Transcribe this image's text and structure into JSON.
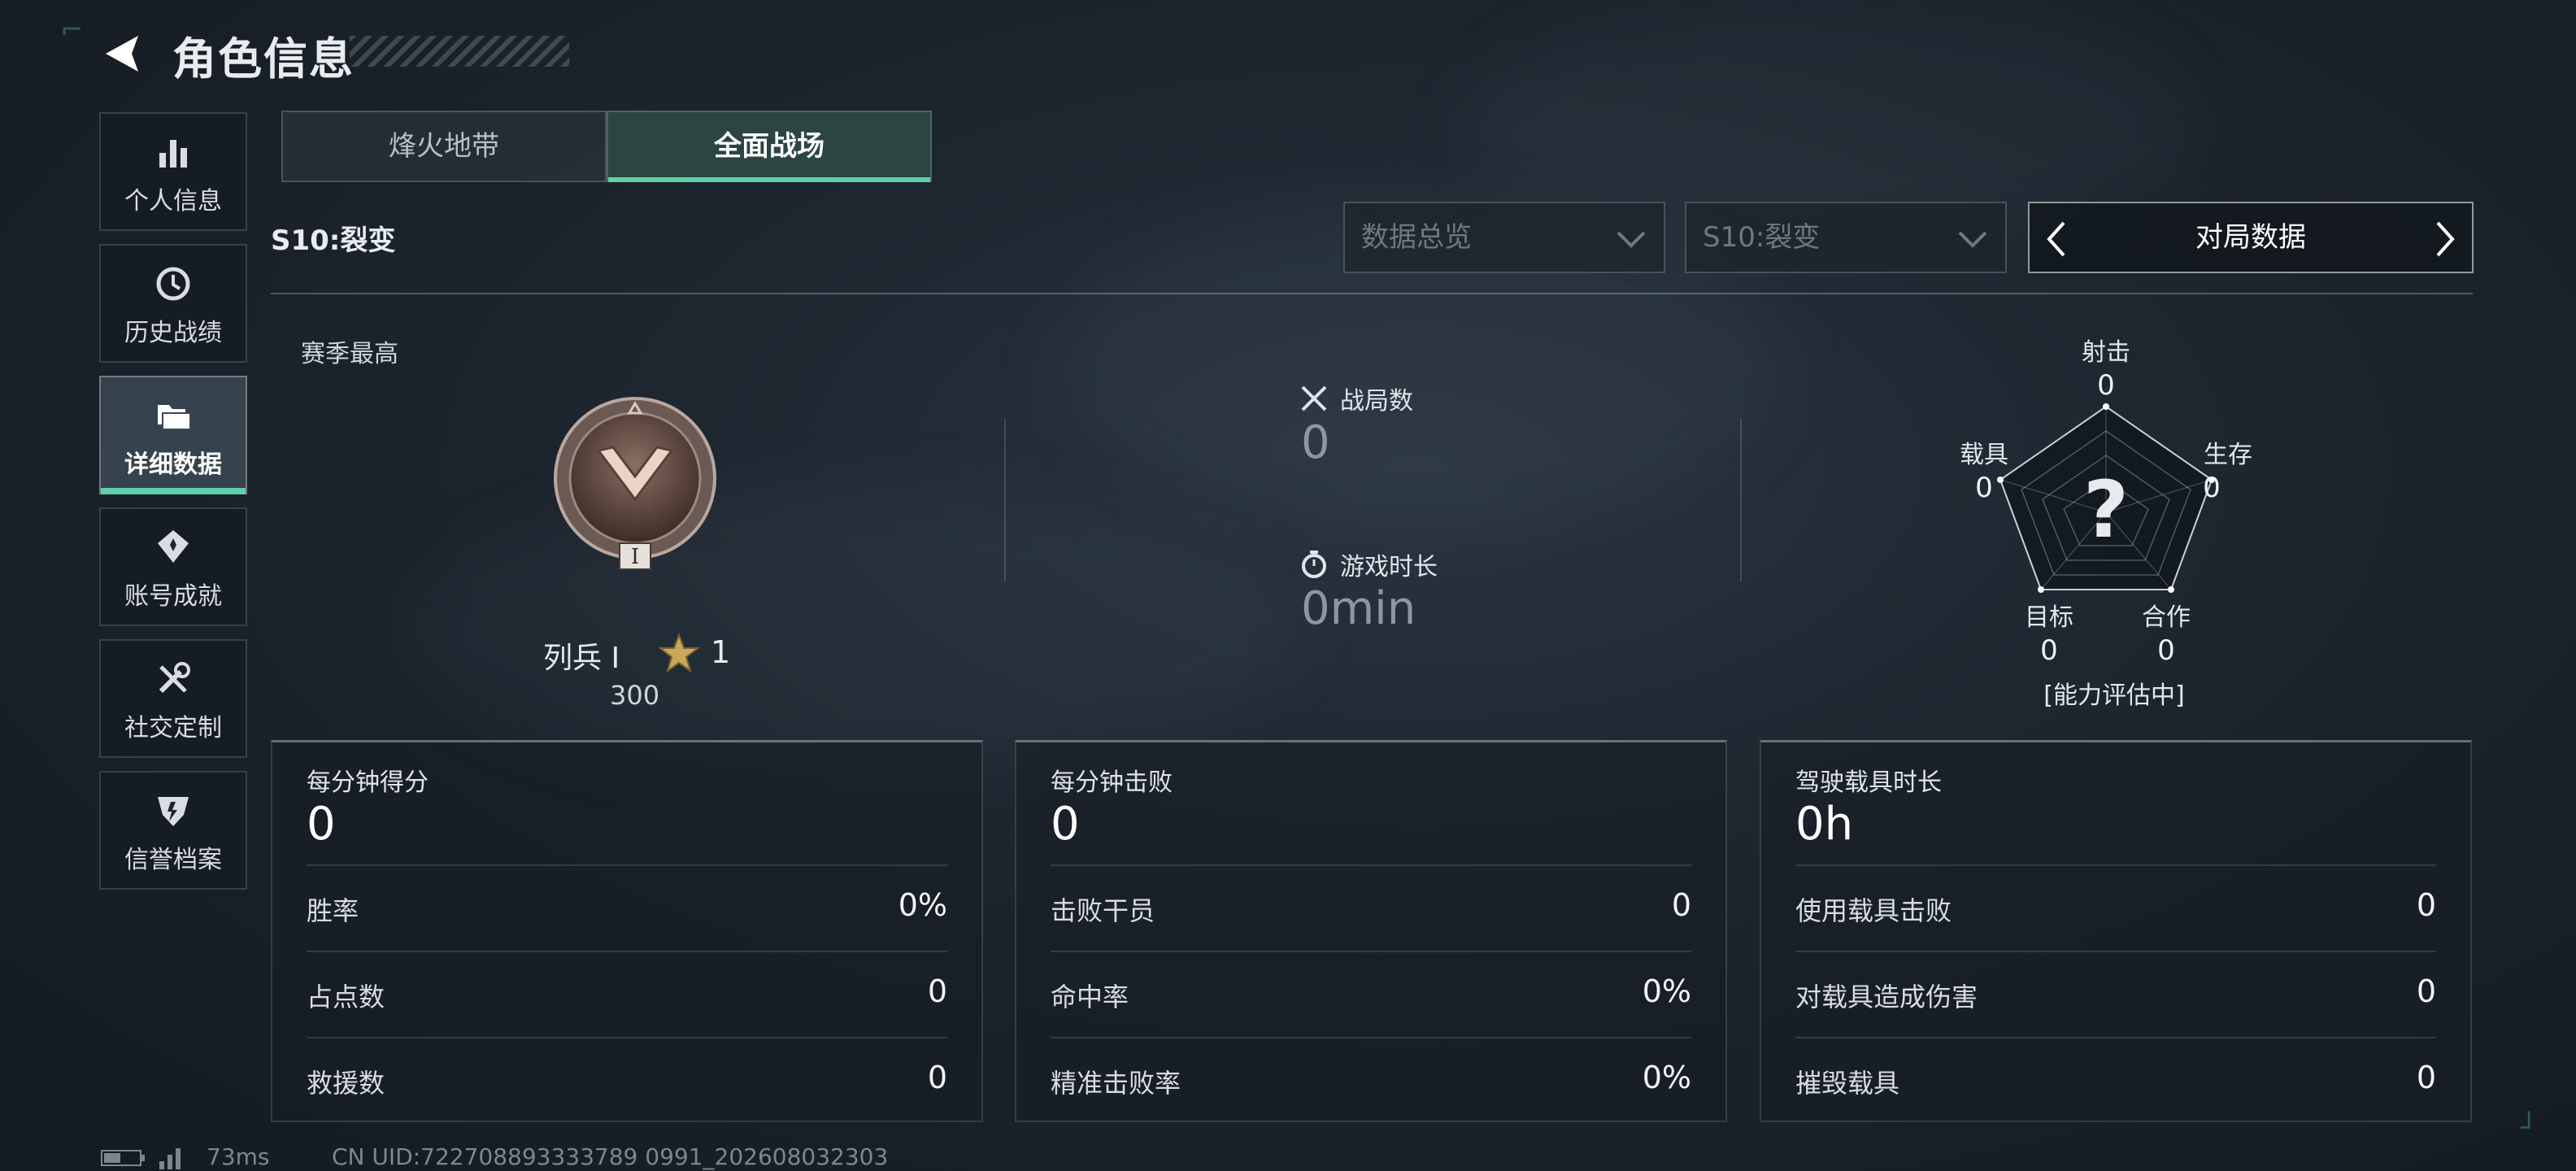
{
  "header": {
    "title": "角色信息"
  },
  "sidebar": {
    "items": [
      {
        "label": "个人信息",
        "icon": "bar-chart-icon"
      },
      {
        "label": "历史战绩",
        "icon": "history-clock-icon"
      },
      {
        "label": "详细数据",
        "icon": "folder-icon",
        "active": true
      },
      {
        "label": "账号成就",
        "icon": "achievement-icon"
      },
      {
        "label": "社交定制",
        "icon": "tools-icon"
      },
      {
        "label": "信誉档案",
        "icon": "credit-shield-icon"
      }
    ]
  },
  "tabs": [
    {
      "label": "烽火地带",
      "active": false
    },
    {
      "label": "全面战场",
      "active": true
    }
  ],
  "season_title": "S10:裂变",
  "filters": {
    "overview": "数据总览",
    "season": "S10:裂变",
    "pager_label": "对局数据"
  },
  "rank": {
    "label": "赛季最高",
    "name": "列兵 Ⅰ",
    "stars": "1",
    "score": "300",
    "badge_numeral": "I"
  },
  "stats": {
    "matches_label": "战局数",
    "matches_value": "0",
    "playtime_label": "游戏时长",
    "playtime_value": "0min"
  },
  "radar": {
    "center_mark": "?",
    "axes": [
      {
        "label": "射击",
        "value": "0"
      },
      {
        "label": "生存",
        "value": "0"
      },
      {
        "label": "合作",
        "value": "0"
      },
      {
        "label": "目标",
        "value": "0"
      },
      {
        "label": "载具",
        "value": "0"
      }
    ],
    "status": "[能力评估中]"
  },
  "cards": [
    {
      "title": "每分钟得分",
      "value": "0",
      "rows": [
        {
          "k": "胜率",
          "v": "0%"
        },
        {
          "k": "占点数",
          "v": "0"
        },
        {
          "k": "救援数",
          "v": "0"
        }
      ]
    },
    {
      "title": "每分钟击败",
      "value": "0",
      "rows": [
        {
          "k": "击败干员",
          "v": "0"
        },
        {
          "k": "命中率",
          "v": "0%"
        },
        {
          "k": "精准击败率",
          "v": "0%"
        }
      ]
    },
    {
      "title": "驾驶载具时长",
      "value": "0h",
      "rows": [
        {
          "k": "使用载具击败",
          "v": "0"
        },
        {
          "k": "对载具造成伤害",
          "v": "0"
        },
        {
          "k": "摧毁载具",
          "v": "0"
        }
      ]
    }
  ],
  "status_bar": {
    "ping": "73ms",
    "uid": "CN UID:722708893333789 0991_202608032303"
  },
  "colors": {
    "accent": "#5fd0a8",
    "background": "#1c242d"
  }
}
